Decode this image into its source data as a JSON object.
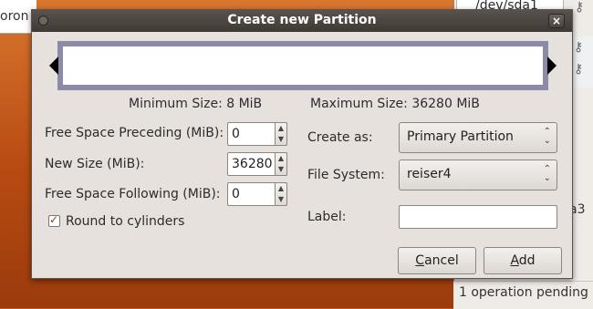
{
  "background": {
    "left_text": "oron",
    "device": "/dev/sda1",
    "side_text": "a3 (",
    "status": "1 operation pending"
  },
  "dialog": {
    "title": "Create new Partition",
    "close_glyph": "×",
    "min_size": "Minimum Size: 8 MiB",
    "max_size": "Maximum Size: 36280 MiB",
    "fields": {
      "free_before_label": "Free Space Preceding (MiB):",
      "free_before_value": "0",
      "new_size_label": "New Size (MiB):",
      "new_size_value": "36280",
      "free_after_label": "Free Space Following (MiB):",
      "free_after_value": "0",
      "round_label": "Round to cylinders",
      "round_checked": true,
      "create_as_label": "Create as:",
      "create_as_value": "Primary Partition",
      "fs_label": "File System:",
      "fs_value": "reiser4",
      "label_label": "Label:",
      "label_value": ""
    },
    "buttons": {
      "cancel_pre": "",
      "cancel_key": "C",
      "cancel_post": "ancel",
      "add_pre": "",
      "add_key": "A",
      "add_post": "dd"
    },
    "colors": {
      "graphic_border": "#8b8aa8",
      "titlebar": "#4a433f"
    }
  }
}
